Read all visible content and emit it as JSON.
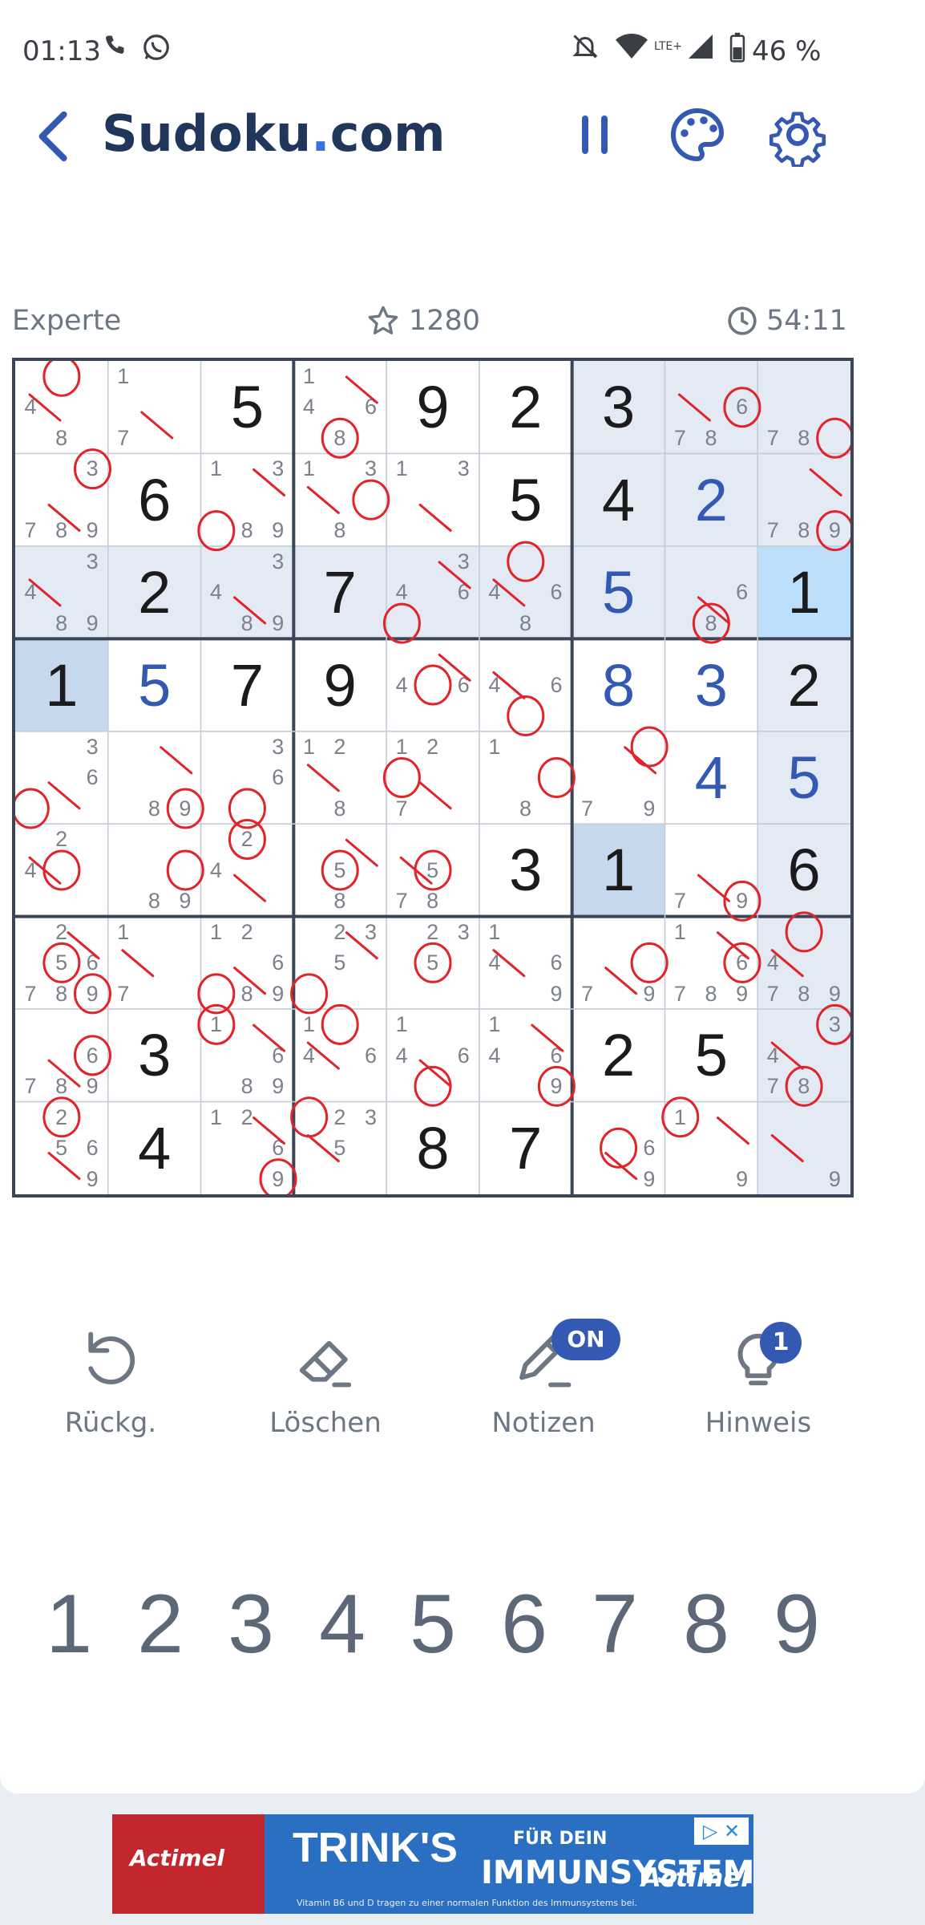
{
  "status_bar": {
    "time": "01:13",
    "battery": "46 %",
    "network": "LTE+"
  },
  "header": {
    "title_main": "Sudoku",
    "title_dot": ".",
    "title_tld": "com"
  },
  "info": {
    "difficulty": "Experte",
    "score": "1280",
    "timer": "54:11"
  },
  "colors": {
    "accent": "#3359b3",
    "title": "#20365a",
    "mark": "#e0242a",
    "given": "#1b1b1b",
    "highlight": "#e3eaf3",
    "selected": "#bcdffb"
  },
  "board": {
    "rows": [
      [
        "",
        "",
        "5",
        "",
        "9",
        "2",
        "3",
        "",
        ""
      ],
      [
        "",
        "6",
        "",
        "",
        "",
        "5",
        "4",
        "2",
        ""
      ],
      [
        "",
        "2",
        "",
        "7",
        "",
        "",
        "5",
        "",
        "1"
      ],
      [
        "1",
        "5",
        "7",
        "9",
        "",
        "",
        "8",
        "3",
        "2"
      ],
      [
        "",
        "",
        "",
        "",
        "",
        "",
        "",
        "4",
        "5"
      ],
      [
        "",
        "",
        "",
        "",
        "",
        "3",
        "1",
        "",
        "6"
      ],
      [
        "",
        "",
        "",
        "",
        "",
        "",
        "",
        "",
        ""
      ],
      [
        "",
        "3",
        "",
        "",
        "",
        "",
        "2",
        "5",
        ""
      ],
      [
        "",
        "4",
        "",
        "",
        "8",
        "7",
        "",
        "",
        ""
      ]
    ],
    "user_entered": [
      [
        1,
        7
      ],
      [
        3,
        1
      ],
      [
        3,
        6
      ],
      [
        3,
        7
      ],
      [
        4,
        7
      ],
      [
        4,
        8
      ],
      [
        2,
        6
      ]
    ],
    "selected_cell": [
      2,
      8
    ],
    "notes": {
      "0,0": [
        "4",
        "8"
      ],
      "0,1": [
        "1",
        "7"
      ],
      "0,3": [
        "1",
        "4",
        "6",
        "8"
      ],
      "0,7": [
        "6",
        "7",
        "8"
      ],
      "0,8": [
        "7",
        "8"
      ],
      "1,0": [
        "3",
        "7",
        "8",
        "9"
      ],
      "1,2": [
        "1",
        "3",
        "8",
        "9"
      ],
      "1,3": [
        "1",
        "3",
        "8"
      ],
      "1,4": [
        "1",
        "3"
      ],
      "1,8": [
        "7",
        "8",
        "9"
      ],
      "2,0": [
        "3",
        "4",
        "8",
        "9"
      ],
      "2,2": [
        "3",
        "4",
        "8",
        "9"
      ],
      "2,4": [
        "3",
        "4",
        "6"
      ],
      "2,5": [
        "4",
        "6",
        "8"
      ],
      "2,7": [
        "6",
        "8"
      ],
      "3,4": [
        "4",
        "6"
      ],
      "3,5": [
        "4",
        "6"
      ],
      "4,0": [
        "3",
        "6"
      ],
      "4,1": [
        "8",
        "9"
      ],
      "4,2": [
        "3",
        "6"
      ],
      "4,3": [
        "1",
        "2",
        "8"
      ],
      "4,4": [
        "1",
        "2",
        "7"
      ],
      "4,5": [
        "1",
        "8"
      ],
      "4,6": [
        "7",
        "9"
      ],
      "5,0": [
        "2",
        "4"
      ],
      "5,1": [
        "8",
        "9"
      ],
      "5,2": [
        "2",
        "4"
      ],
      "5,3": [
        "5",
        "8"
      ],
      "5,4": [
        "5",
        "7",
        "8"
      ],
      "5,7": [
        "7",
        "9"
      ],
      "6,0": [
        "2",
        "5",
        "6",
        "7",
        "8",
        "9"
      ],
      "6,1": [
        "1",
        "7"
      ],
      "6,2": [
        "1",
        "2",
        "6",
        "8",
        "9"
      ],
      "6,3": [
        "2",
        "3",
        "5"
      ],
      "6,4": [
        "2",
        "3",
        "5"
      ],
      "6,5": [
        "1",
        "4",
        "6",
        "9"
      ],
      "6,6": [
        "7",
        "9"
      ],
      "6,7": [
        "1",
        "6",
        "7",
        "8",
        "9"
      ],
      "6,8": [
        "4",
        "7",
        "8",
        "9"
      ],
      "7,0": [
        "6",
        "7",
        "8",
        "9"
      ],
      "7,2": [
        "1",
        "6",
        "8",
        "9"
      ],
      "7,3": [
        "1",
        "4",
        "6"
      ],
      "7,4": [
        "1",
        "4",
        "6"
      ],
      "7,5": [
        "1",
        "4",
        "6",
        "9"
      ],
      "7,8": [
        "3",
        "4",
        "7",
        "8"
      ],
      "8,0": [
        "2",
        "5",
        "6",
        "9"
      ],
      "8,2": [
        "1",
        "2",
        "6",
        "9"
      ],
      "8,3": [
        "2",
        "3",
        "5"
      ],
      "8,6": [
        "6",
        "9"
      ],
      "8,7": [
        "1",
        "9"
      ],
      "8,8": [
        "9"
      ]
    }
  },
  "tools": [
    {
      "label": "Rückg.",
      "icon": "undo-icon"
    },
    {
      "label": "Löschen",
      "icon": "eraser-icon"
    },
    {
      "label": "Notizen",
      "icon": "pencil-icon",
      "badge": "ON"
    },
    {
      "label": "Hinweis",
      "icon": "lightbulb-icon",
      "badge": "1"
    }
  ],
  "keypad": [
    "1",
    "2",
    "3",
    "4",
    "5",
    "6",
    "7",
    "8",
    "9"
  ],
  "ad": {
    "brand": "Actimel",
    "headline1": "TRINK'S",
    "headline2": "FÜR DEIN",
    "headline3": "IMMUNSYSTEM",
    "fine_print": "Vitamin B6 und D tragen zu einer normalen Funktion des Immunsystems bei."
  }
}
